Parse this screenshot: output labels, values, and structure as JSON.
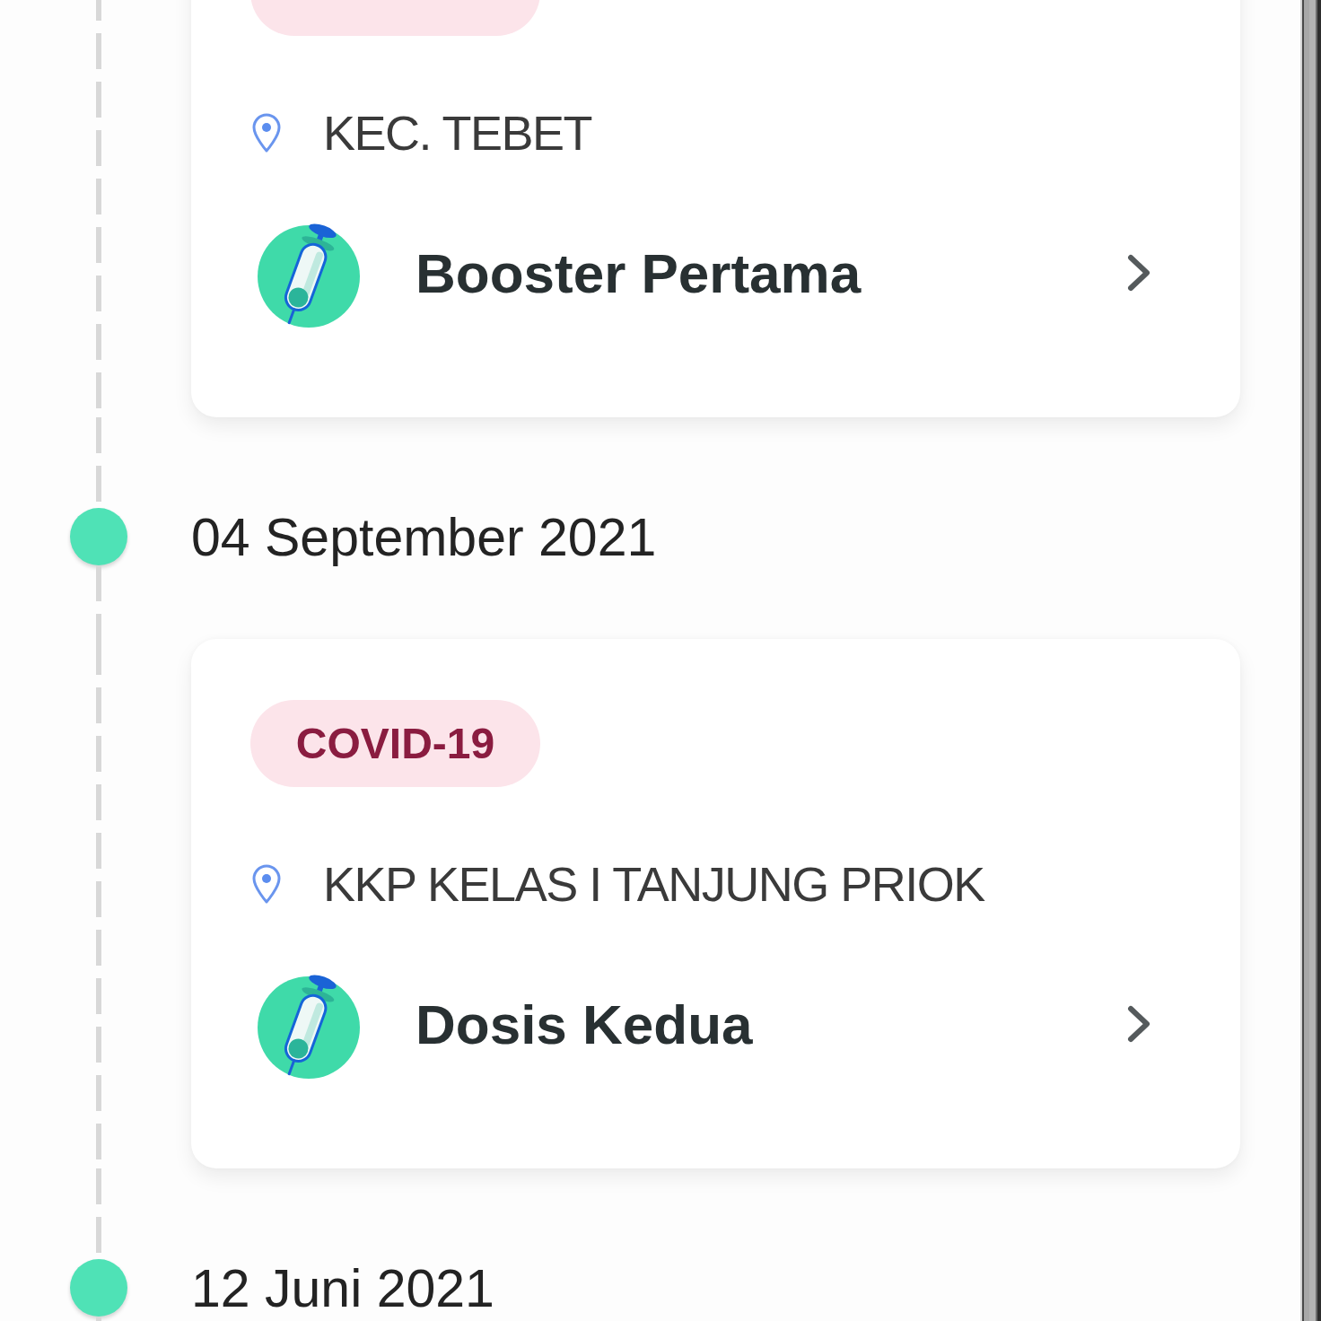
{
  "timeline": [
    {
      "kind": "record",
      "location": "KEC. TEBET",
      "dose": "Booster Pertama"
    },
    {
      "kind": "date",
      "date": "04 September 2021"
    },
    {
      "kind": "record",
      "category": "COVID-19",
      "location": "KKP KELAS I TANJUNG PRIOK",
      "dose": "Dosis Kedua"
    },
    {
      "kind": "date",
      "date": "12 Juni 2021"
    }
  ]
}
